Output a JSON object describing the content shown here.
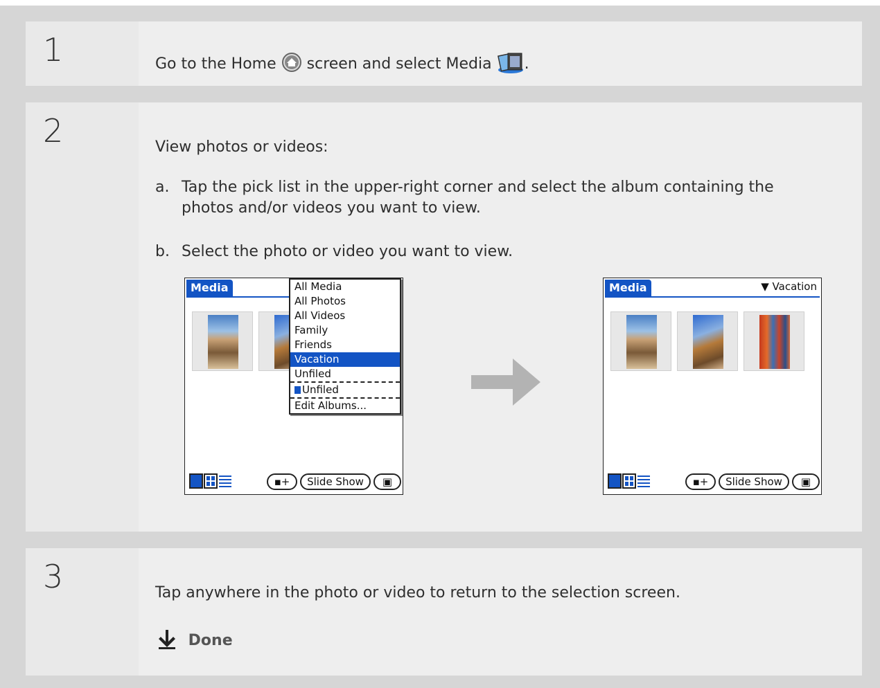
{
  "steps": [
    {
      "number": "1",
      "text_before": "Go to the Home",
      "text_middle": "screen and select Media",
      "text_after": ".",
      "icons": [
        "home-icon",
        "media-app-icon"
      ]
    },
    {
      "number": "2",
      "intro": "View photos or videos:",
      "sub_a_label": "a.",
      "sub_a_line1": "Tap the pick list in the upper-right corner and select the album containing the",
      "sub_a_line2": "photos and/or videos you want to view.",
      "sub_b_label": "b.",
      "sub_b_text": "Select the photo or video you want to view.",
      "screen_left": {
        "title": "Media",
        "menu_items": [
          "All Media",
          "All Photos",
          "All Videos",
          "Family",
          "Friends",
          "Vacation",
          "Unfiled",
          "Unfiled",
          "Edit Albums..."
        ],
        "selected": "Vacation",
        "slideshow_label": "Slide Show"
      },
      "screen_right": {
        "title": "Media",
        "picklist_value": "Vacation",
        "slideshow_label": "Slide Show"
      }
    },
    {
      "number": "3",
      "text": "Tap anywhere in the photo or video to return to the selection screen.",
      "done_label": "Done"
    }
  ],
  "colors": {
    "palm_blue": "#1354c4",
    "step_bg": "#eeeeee",
    "frame": "#d6d6d6",
    "arrow": "#b3b3b3"
  }
}
